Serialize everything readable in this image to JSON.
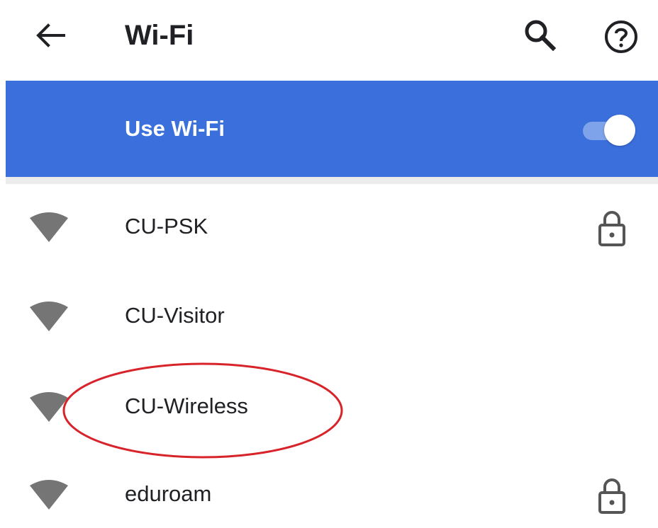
{
  "appbar": {
    "title": "Wi-Fi",
    "back_icon": "arrow-back-icon",
    "search_icon": "search-icon",
    "help_icon": "help-circle-icon"
  },
  "wifi_toggle": {
    "label": "Use Wi-Fi",
    "state": "on"
  },
  "networks": [
    {
      "name": "CU-PSK",
      "secured": true
    },
    {
      "name": "CU-Visitor",
      "secured": false
    },
    {
      "name": "CU-Wireless",
      "secured": false,
      "highlighted": true
    },
    {
      "name": "eduroam",
      "secured": true
    }
  ],
  "colors": {
    "accent": "#3b6fdc",
    "toggle_track": "#7fa3ea",
    "icon_gray": "#757575",
    "highlight": "#d8232a"
  }
}
